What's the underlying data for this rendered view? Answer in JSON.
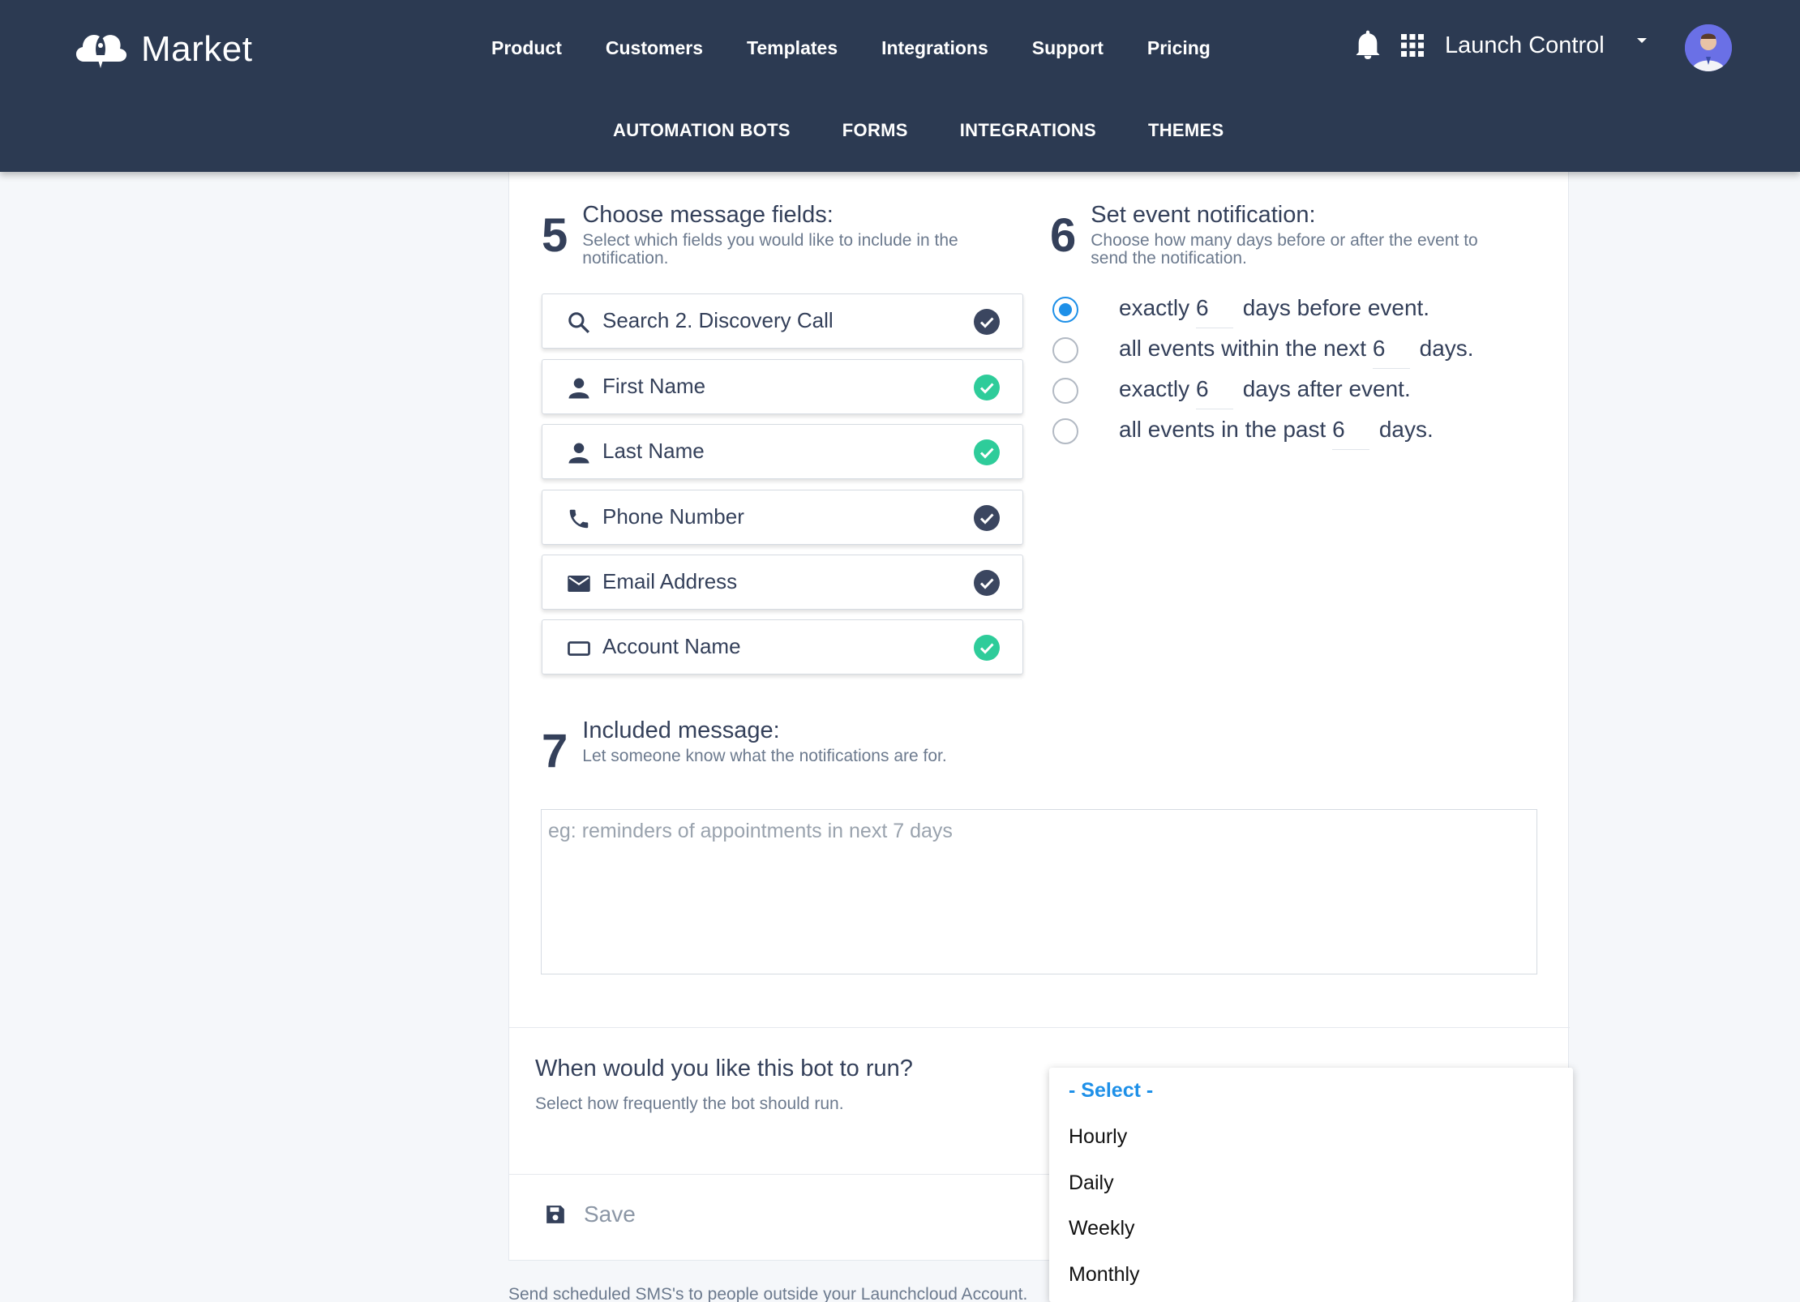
{
  "brand": {
    "name": "Market",
    "logo_icon": "rocket-cloud-icon"
  },
  "main_nav": [
    "Product",
    "Customers",
    "Templates",
    "Integrations",
    "Support",
    "Pricing"
  ],
  "sub_nav": [
    "AUTOMATION BOTS",
    "FORMS",
    "INTEGRATIONS",
    "THEMES"
  ],
  "account": {
    "name": "Launch Control",
    "icons": [
      "bell-icon",
      "apps-grid-icon",
      "caret-down-icon"
    ]
  },
  "step5": {
    "number": "5",
    "title": "Choose message fields:",
    "subtitle_line1": "Select which fields you would like to include in the",
    "subtitle_line2": "notification.",
    "fields": [
      {
        "label": "Search 2. Discovery Call",
        "icon": "search-icon",
        "check": "dark"
      },
      {
        "label": "First Name",
        "icon": "person-icon",
        "check": "green"
      },
      {
        "label": "Last Name",
        "icon": "person-icon",
        "check": "green"
      },
      {
        "label": "Phone Number",
        "icon": "phone-icon",
        "check": "dark"
      },
      {
        "label": "Email Address",
        "icon": "envelope-icon",
        "check": "dark"
      },
      {
        "label": "Account Name",
        "icon": "rectangle-icon",
        "check": "green"
      }
    ]
  },
  "step6": {
    "number": "6",
    "title": "Set event notification:",
    "subtitle_line1": "Choose how many days before or after the event to",
    "subtitle_line2": "send the notification.",
    "options": [
      {
        "pre": "exactly",
        "value": "6",
        "post": "days before event.",
        "selected": true
      },
      {
        "pre": "all events within the next",
        "value": "6",
        "post": "days.",
        "selected": false
      },
      {
        "pre": "exactly",
        "value": "6",
        "post": "days after event.",
        "selected": false
      },
      {
        "pre": "all events in the past",
        "value": "6",
        "post": "days.",
        "selected": false
      }
    ]
  },
  "step7": {
    "number": "7",
    "title": "Included message:",
    "subtitle": "Let someone know what the notifications are for.",
    "placeholder": "eg: reminders of appointments in next 7 days"
  },
  "run": {
    "title": "When would you like this bot to run?",
    "subtitle": "Select how frequently the bot should run.",
    "options": [
      "- Select -",
      "Hourly",
      "Daily",
      "Weekly",
      "Monthly"
    ],
    "selected": "- Select -"
  },
  "save_label": "Save",
  "footer_note": "Send scheduled SMS's to people outside your Launchcloud Account.",
  "colors": {
    "header": "#2c3a52",
    "accent": "#1e90e8",
    "check_green": "#2ecc9a",
    "check_dark": "#3b4660"
  }
}
